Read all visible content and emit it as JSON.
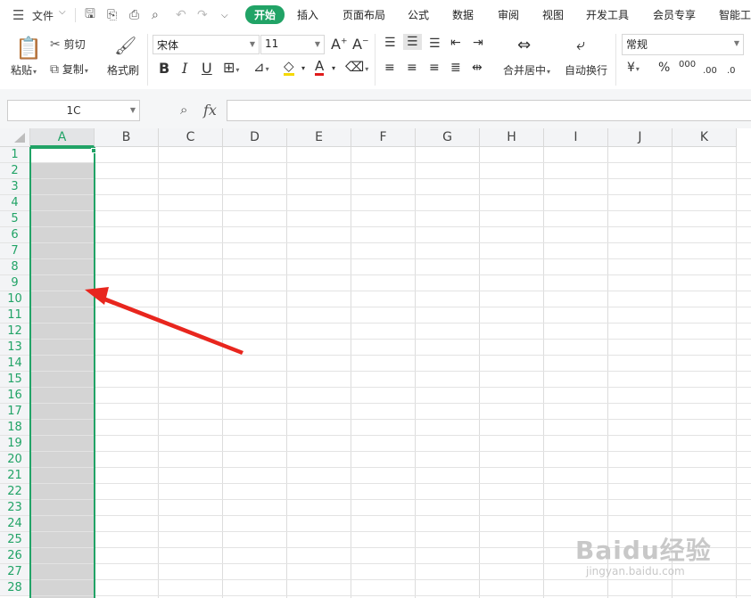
{
  "menubar": {
    "file_label": "文件",
    "tabs": [
      "开始",
      "插入",
      "页面布局",
      "公式",
      "数据",
      "审阅",
      "视图",
      "开发工具",
      "会员专享",
      "智能工"
    ]
  },
  "ribbon": {
    "paste": "粘贴",
    "cut": "剪切",
    "copy": "复制",
    "format_painter": "格式刷",
    "font_name": "宋体",
    "font_size": "11",
    "merge_center": "合并居中",
    "wrap_text": "自动换行",
    "number_format": "常规",
    "currency": "¥",
    "percent": "%",
    "thousands": "000",
    "dec_increase": ".00",
    "dec_decrease": ".0"
  },
  "formula_bar": {
    "name_box": "1C",
    "fx": "fx",
    "formula": ""
  },
  "grid": {
    "columns": [
      "A",
      "B",
      "C",
      "D",
      "E",
      "F",
      "G",
      "H",
      "I",
      "J",
      "K"
    ],
    "rows": [
      "1",
      "2",
      "3",
      "4",
      "5",
      "6",
      "7",
      "8",
      "9",
      "10",
      "11",
      "12",
      "13",
      "14",
      "15",
      "16",
      "17",
      "18",
      "19",
      "20",
      "21",
      "22",
      "23",
      "24",
      "25",
      "26",
      "27",
      "28"
    ],
    "selected_column": "A"
  },
  "watermark": {
    "main": "Baidu经验",
    "sub": "jingyan.baidu.com"
  },
  "colors": {
    "accent": "#21a366",
    "selection_fill": "#d4d4d4",
    "arrow": "#e8261e"
  }
}
